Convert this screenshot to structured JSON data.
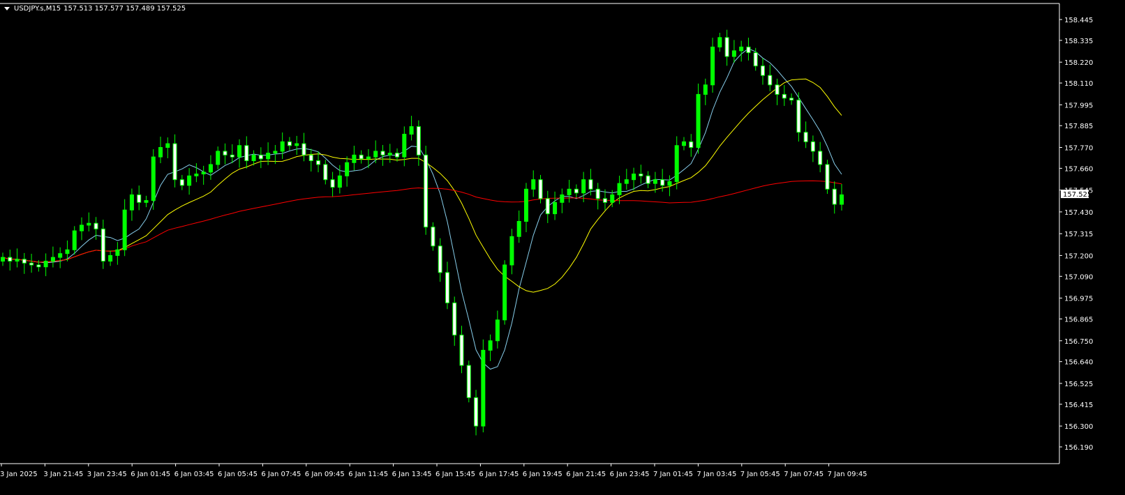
{
  "header": {
    "symbol": "USDJPY.s,M15",
    "ohlc": "157.513 157.577 157.489 157.525"
  },
  "colors": {
    "background": "#000000",
    "grid_frame": "#ffffff",
    "bull_candle": "#00ff00",
    "bear_candle": "#ffffff",
    "ma_fast": "#87ceeb",
    "ma_medium": "#ffff00",
    "ma_slow": "#ff0000"
  },
  "chart_data": {
    "type": "line",
    "y_axis": {
      "range": [
        156.19,
        158.445
      ],
      "ticks": [
        "158.445",
        "158.335",
        "158.220",
        "158.110",
        "157.995",
        "157.885",
        "157.770",
        "157.660",
        "157.545",
        "157.430",
        "157.315",
        "157.200",
        "157.090",
        "156.975",
        "156.865",
        "156.750",
        "156.640",
        "156.525",
        "156.415",
        "156.300",
        "156.190"
      ]
    },
    "x_axis": {
      "ticks": [
        "3 Jan 2025",
        "3 Jan 21:45",
        "3 Jan 23:45",
        "6 Jan 01:45",
        "6 Jan 03:45",
        "6 Jan 05:45",
        "6 Jan 07:45",
        "6 Jan 09:45",
        "6 Jan 11:45",
        "6 Jan 13:45",
        "6 Jan 15:45",
        "6 Jan 17:45",
        "6 Jan 19:45",
        "6 Jan 21:45",
        "6 Jan 23:45",
        "7 Jan 01:45",
        "7 Jan 03:45",
        "7 Jan 05:45",
        "7 Jan 07:45",
        "7 Jan 09:45"
      ]
    },
    "current_price": "157.525",
    "close_series": [
      157.19,
      157.17,
      157.18,
      157.16,
      157.15,
      157.14,
      157.17,
      157.19,
      157.21,
      157.23,
      157.33,
      157.36,
      157.37,
      157.34,
      157.17,
      157.2,
      157.23,
      157.44,
      157.52,
      157.48,
      157.49,
      157.72,
      157.77,
      157.79,
      157.6,
      157.57,
      157.62,
      157.63,
      157.64,
      157.68,
      157.75,
      157.73,
      157.72,
      157.78,
      157.7,
      157.73,
      157.71,
      157.74,
      157.75,
      157.8,
      157.78,
      157.79,
      157.73,
      157.7,
      157.68,
      157.6,
      157.56,
      157.62,
      157.69,
      157.73,
      157.71,
      157.72,
      157.75,
      157.73,
      157.74,
      157.72,
      157.84,
      157.88,
      157.73,
      157.35,
      157.25,
      157.11,
      156.95,
      156.78,
      156.62,
      156.45,
      156.3,
      156.7,
      156.75,
      156.86,
      157.15,
      157.3,
      157.38,
      157.55,
      157.6,
      157.5,
      157.42,
      157.48,
      157.52,
      157.55,
      157.53,
      157.6,
      157.55,
      157.5,
      157.48,
      157.52,
      157.58,
      157.6,
      157.63,
      157.62,
      157.58,
      157.6,
      157.57,
      157.59,
      157.78,
      157.8,
      157.77,
      158.05,
      158.1,
      158.3,
      158.35,
      158.25,
      158.28,
      158.3,
      158.27,
      158.2,
      158.15,
      158.1,
      158.05,
      158.03,
      158.02,
      157.85,
      157.8,
      157.75,
      157.68,
      157.55,
      157.47,
      157.52
    ]
  }
}
